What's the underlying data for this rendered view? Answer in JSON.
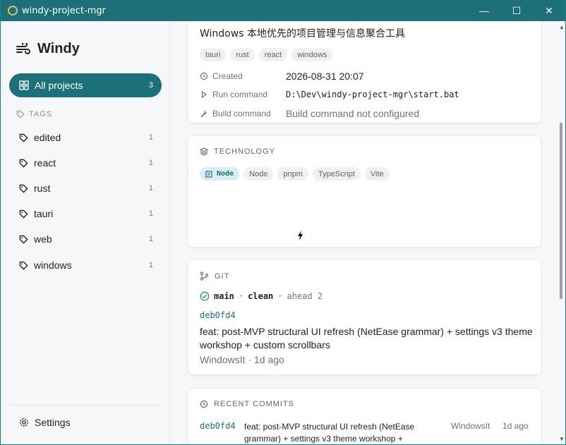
{
  "window": {
    "title": "windy-project-mgr",
    "controls": {
      "minimize": "—",
      "maximize": "☐",
      "close": "✕"
    }
  },
  "sidebar": {
    "brand": "Windy",
    "all_projects": {
      "label": "All projects",
      "count": "3"
    },
    "tags_heading": "TAGS",
    "tags": [
      {
        "label": "edited",
        "count": "1"
      },
      {
        "label": "react",
        "count": "1"
      },
      {
        "label": "rust",
        "count": "1"
      },
      {
        "label": "tauri",
        "count": "1"
      },
      {
        "label": "web",
        "count": "1"
      },
      {
        "label": "windows",
        "count": "1"
      }
    ],
    "settings": "Settings"
  },
  "project": {
    "description": "Windows 本地优先的项目管理与信息聚合工具",
    "tags": [
      "tauri",
      "rust",
      "react",
      "windows"
    ],
    "meta": {
      "created_label": "Created",
      "created_value": "2026-08-31 20:07",
      "run_label": "Run command",
      "run_value": "D:\\Dev\\windy-project-mgr\\start.bat",
      "build_label": "Build command",
      "build_value": "Build command not configured"
    }
  },
  "technology": {
    "heading": "TECHNOLOGY",
    "chips": [
      "Node",
      "Node",
      "pnpm",
      "TypeScript",
      "Vite"
    ]
  },
  "git": {
    "heading": "GIT",
    "branch": "main",
    "sep1": "·",
    "state": "clean",
    "sep2": "·",
    "ahead": "ahead 2",
    "hash": "deb0fd4",
    "message": "feat: post-MVP structural UI refresh (NetEase grammar) + settings v3 theme workshop + custom scrollbars",
    "author_time": "WindowsIt · 1d ago"
  },
  "recent_commits": {
    "heading": "RECENT COMMITS",
    "items": [
      {
        "hash": "deb0fd4",
        "message": "feat: post-MVP structural UI refresh (NetEase grammar) + settings v3 theme workshop +",
        "author": "WindowsIt",
        "time": "1d ago"
      }
    ]
  },
  "colors": {
    "accent": "#1d6f79",
    "accent_soft": "#d9eef0",
    "chip_bg": "#eef0f1"
  }
}
